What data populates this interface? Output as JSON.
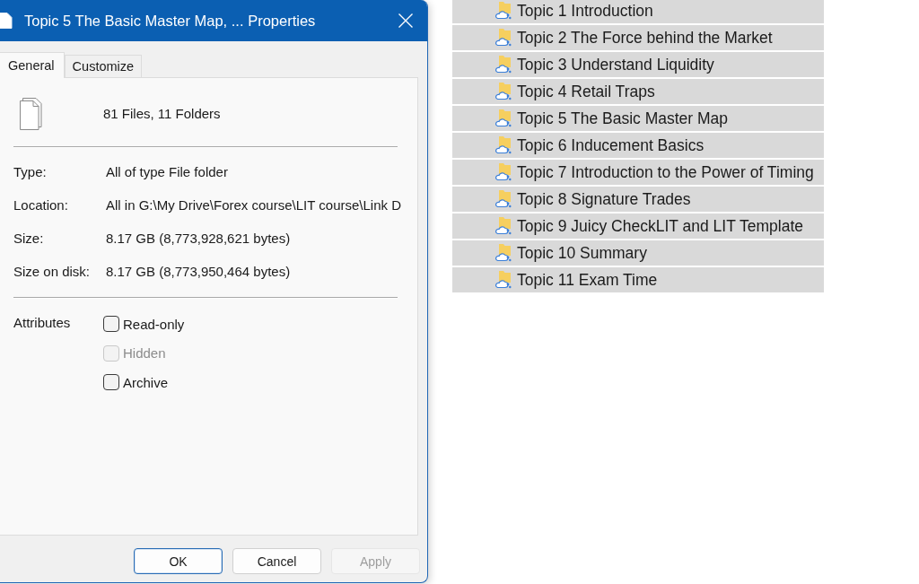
{
  "dialog": {
    "title": "Topic 5 The Basic Master Map, ... Properties",
    "tabs": [
      {
        "label": "General",
        "selected": true
      },
      {
        "label": "Customize",
        "selected": false
      }
    ],
    "summary": "81 Files, 11 Folders",
    "properties": [
      {
        "label": "Type:",
        "value": "All of type File folder"
      },
      {
        "label": "Location:",
        "value": "All in G:\\My Drive\\Forex course\\LIT course\\Link D"
      },
      {
        "label": "Size:",
        "value": "8.17 GB (8,773,928,621 bytes)"
      },
      {
        "label": "Size on disk:",
        "value": "8.17 GB (8,773,950,464 bytes)"
      }
    ],
    "attributes": {
      "label": "Attributes",
      "options": [
        {
          "label": "Read-only",
          "checked": false,
          "disabled": false
        },
        {
          "label": "Hidden",
          "checked": false,
          "disabled": true
        },
        {
          "label": "Archive",
          "checked": false,
          "disabled": false
        }
      ]
    },
    "buttons": [
      {
        "label": "OK",
        "default": true,
        "disabled": false
      },
      {
        "label": "Cancel",
        "default": false,
        "disabled": false
      },
      {
        "label": "Apply",
        "default": false,
        "disabled": true
      }
    ]
  },
  "folder_list": {
    "items": [
      {
        "name": "Topic 1 Introduction",
        "selected": true
      },
      {
        "name": "Topic 2 The Force behind the Market",
        "selected": true
      },
      {
        "name": "Topic 3 Understand Liquidity",
        "selected": true
      },
      {
        "name": "Topic 4 Retail Traps",
        "selected": true
      },
      {
        "name": "Topic 5 The Basic Master Map",
        "selected": true
      },
      {
        "name": "Topic 6 Inducement Basics",
        "selected": true
      },
      {
        "name": "Topic 7 Introduction to the Power of Timing",
        "selected": true
      },
      {
        "name": "Topic 8 Signature Trades",
        "selected": true
      },
      {
        "name": "Topic 9 Juicy CheckLIT and LIT Template",
        "selected": true
      },
      {
        "name": "Topic 10 Summary",
        "selected": true
      },
      {
        "name": "Topic 11 Exam Time",
        "selected": true
      }
    ]
  }
}
